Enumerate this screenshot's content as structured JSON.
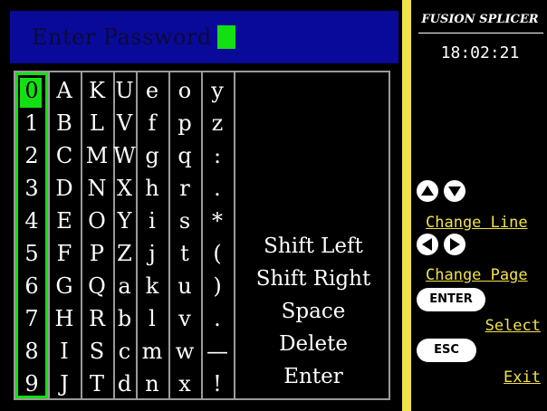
{
  "header": {
    "password_placeholder": "Enter Password"
  },
  "keypad": {
    "columns": [
      [
        "0",
        "1",
        "2",
        "3",
        "4",
        "5",
        "6",
        "7",
        "8",
        "9"
      ],
      [
        "A",
        "B",
        "C",
        "D",
        "E",
        "F",
        "G",
        "H",
        "I",
        "J"
      ],
      [
        "K",
        "L",
        "M",
        "N",
        "O",
        "P",
        "Q",
        "R",
        "S",
        "T"
      ],
      [
        "U",
        "V",
        "W",
        "X",
        "Y",
        "Z",
        "a",
        "b",
        "c",
        "d"
      ],
      [
        "e",
        "f",
        "g",
        "h",
        "i",
        "j",
        "k",
        "l",
        "m",
        "n"
      ],
      [
        "o",
        "p",
        "q",
        "r",
        "s",
        "t",
        "u",
        "v",
        "w",
        "x"
      ],
      [
        "y",
        "z",
        ":",
        ".",
        "*",
        "(",
        ")",
        ".",
        "—",
        "!"
      ]
    ],
    "selected": "0",
    "actions": [
      "Shift Left",
      "Shift Right",
      "Space",
      "Delete",
      "Enter"
    ]
  },
  "sidebar": {
    "title": "FUSION SPLICER",
    "time": "18:02:21",
    "change_line_label": "Change Line",
    "change_page_label": "Change Page",
    "enter_button_label": "ENTER",
    "select_label": "Select",
    "esc_button_label": "ESC",
    "exit_label": "Exit"
  },
  "colors": {
    "accent_green": "#12e012",
    "sidebar_yellow": "#f2e24a",
    "header_blue": "#0a0a9a"
  }
}
